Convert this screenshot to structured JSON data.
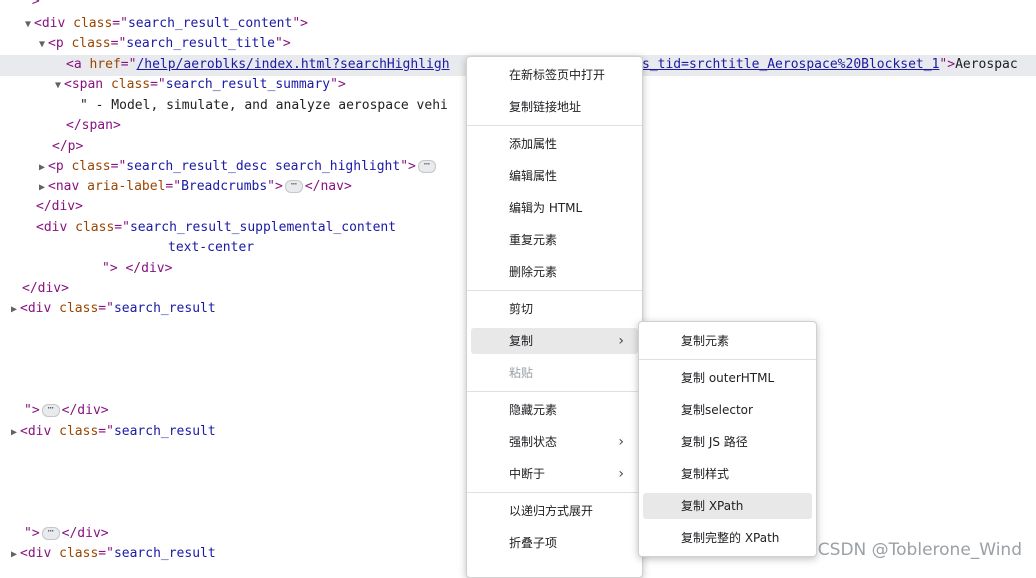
{
  "dom": {
    "l0_text": "\">",
    "l1_open": "<div ",
    "l1_attr": "class",
    "l1_eq": "=\"",
    "l1_val": "search_result_content",
    "l1_close": "\">",
    "l2_open": "<p ",
    "l2_attr": "class",
    "l2_val": "search_result_title",
    "l3_open": "<a ",
    "l3_attr": "href",
    "l3_link": "/help/aeroblks/index.html?searchHighligh",
    "l3_link_tail": "s_tid=srchtitle_Aerospace%20Blockset_1",
    "l3_close": "\">",
    "l3_text": "Aerospac",
    "l4_open": "<span ",
    "l4_attr": "class",
    "l4_val": "search_result_summary",
    "l5_text": "\" - Model, simulate, and analyze aerospace vehi",
    "l6_text": "</span>",
    "l7_text": "</p>",
    "l8_open": "<p ",
    "l8_attr": "class",
    "l8_val": "search_result_desc search_highlight",
    "l9_open": "<nav ",
    "l9_attr": "aria-label",
    "l9_val": "Breadcrumbs",
    "l9_close": "</nav>",
    "l10_text": "</div>",
    "l11_open": "<div ",
    "l11_attr": "class",
    "l11_val": "search_result_supplemental_content",
    "l12_val": "text-center",
    "l13_close": "</div>",
    "l14_text": "</div>",
    "l15_open": "<div ",
    "l15_attr": "class",
    "l15_val": "search_result",
    "l16_end": "</div>",
    "ellipsis": "⋯",
    "tri_down": "▼",
    "tri_right": "▶"
  },
  "context_menu": {
    "items": [
      "在新标签页中打开",
      "复制链接地址",
      "添加属性",
      "编辑属性",
      "编辑为 HTML",
      "重复元素",
      "删除元素",
      "剪切",
      "复制",
      "粘贴",
      "隐藏元素",
      "强制状态",
      "中断于",
      "以递归方式展开",
      "折叠子项"
    ],
    "chevron": "›"
  },
  "submenu": {
    "items": [
      "复制元素",
      "复制 outerHTML",
      "复制selector",
      "复制 JS 路径",
      "复制样式",
      "复制 XPath",
      "复制完整的 XPath"
    ]
  },
  "watermark": "CSDN @Toblerone_Wind",
  "colors": {
    "tag": "#881280",
    "attr": "#994500",
    "value": "#1a1aa6",
    "highlight": "#e8e8e8"
  }
}
